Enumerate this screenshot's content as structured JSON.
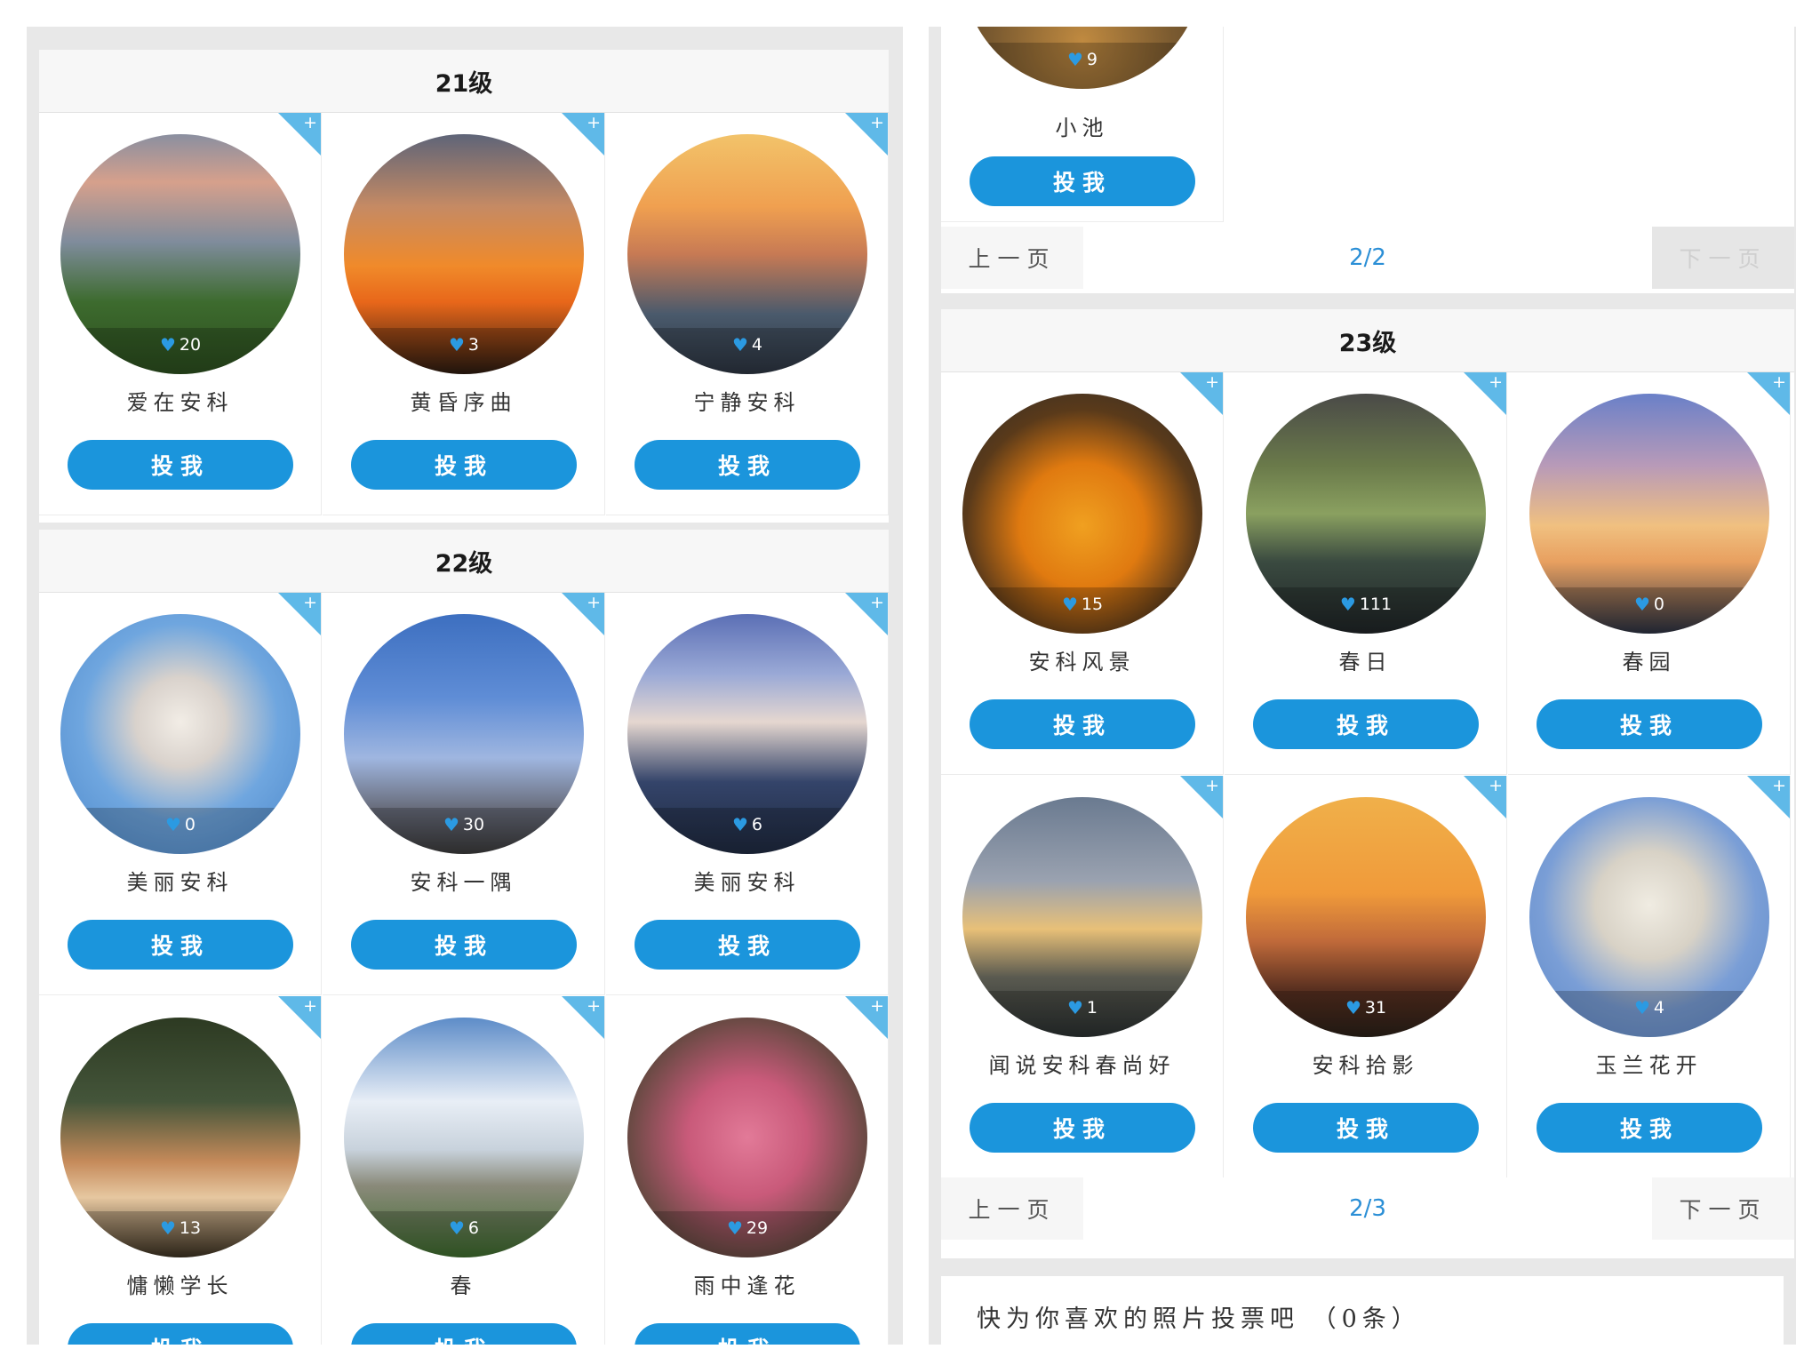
{
  "vote_label": "投我",
  "left": {
    "sections": [
      {
        "title": "21级",
        "cards": [
          {
            "title": "爱在安科",
            "likes": "20",
            "photo": "linear-gradient(180deg,#8a8fa0 0%,#d6a08c 20%,#7f8c9c 45%,#3d6b2e 70%,#2b4d1e 100%)"
          },
          {
            "title": "黄昏序曲",
            "likes": "3",
            "photo": "linear-gradient(180deg,#5e6478 0%,#c58a64 30%,#f08a2a 55%,#e8671a 70%,#2a1a10 100%)"
          },
          {
            "title": "宁静安科",
            "likes": "4",
            "photo": "linear-gradient(180deg,#f2c36a 0%,#f0a050 30%,#c77a54 50%,#4a5a6c 75%,#2c3440 100%)"
          }
        ]
      },
      {
        "title": "22级",
        "cards": [
          {
            "title": "美丽安科",
            "likes": "0",
            "photo": "radial-gradient(circle at 50% 45%,#f2ede6 0%,#d9d2cc 25%,#6fa6df 55%,#4a86c9 100%)"
          },
          {
            "title": "安科一隅",
            "likes": "30",
            "photo": "linear-gradient(180deg,#3d6fc0 0%,#5f8dd6 35%,#9fb6e0 60%,#6b7080 80%,#3a3a3a 100%)"
          },
          {
            "title": "美丽安科",
            "likes": "6",
            "photo": "linear-gradient(180deg,#5b6fb5 0%,#9aa9d6 25%,#e5d7d0 45%,#34446a 70%,#1f2a40 100%)"
          }
        ]
      },
      {
        "title": "",
        "cards": [
          {
            "title": "慵懒学长",
            "likes": "13",
            "photo": "linear-gradient(180deg,#2d3a22 0%,#44553a 35%,#c58a5a 60%,#e6c7a0 75%,#3a3020 100%)"
          },
          {
            "title": "春",
            "likes": "6",
            "photo": "linear-gradient(180deg,#5d8cc8 0%,#e8eef6 35%,#c8d2dc 55%,#8a8a7a 70%,#3d6a2d 100%)"
          },
          {
            "title": "雨中逢花",
            "likes": "29",
            "photo": "radial-gradient(circle at 50% 50%,#e27a98 0%,#c95a7a 35%,#6a4a44 70%,#3b3530 100%)"
          }
        ]
      }
    ]
  },
  "right": {
    "top_card": {
      "title": "小池",
      "likes": "9"
    },
    "top_pager": {
      "prev": "上一页",
      "page": "2/2",
      "next": "下一页"
    },
    "section": {
      "title": "23级",
      "cards": [
        {
          "title": "安科风景",
          "likes": "15",
          "photo": "radial-gradient(circle at 50% 55%,#f0a020 0%,#e07a10 35%,#5a3a1a 65%,#2a2a2a 100%)"
        },
        {
          "title": "春日",
          "likes": "111",
          "photo": "linear-gradient(180deg,#4a4a48 0%,#6a7a4a 30%,#8aa060 50%,#3a4a40 70%,#1f2426 100%)"
        },
        {
          "title": "春园",
          "likes": "0",
          "photo": "linear-gradient(180deg,#6a80c8 0%,#b89ab8 30%,#f0c080 55%,#e8a060 70%,#2a3040 100%)"
        },
        {
          "title": "闻说安科春尚好",
          "likes": "1",
          "photo": "linear-gradient(180deg,#6a7a90 0%,#9aa2b0 35%,#e8c078 55%,#5a5a50 75%,#2a3030 100%)"
        },
        {
          "title": "安科拾影",
          "likes": "31",
          "photo": "linear-gradient(180deg,#f0b04a 0%,#f09a3a 40%,#c06a3a 60%,#5a3020 80%,#2a2018 100%)"
        },
        {
          "title": "玉兰花开",
          "likes": "4",
          "photo": "radial-gradient(circle at 50% 45%,#f0ece2 0%,#d8d2c6 30%,#7a9ed6 60%,#5a86c6 100%)"
        }
      ]
    },
    "bottom_pager": {
      "prev": "上一页",
      "page": "2/3",
      "next": "下一页"
    },
    "footer_text": "快为你喜欢的照片投票吧 （0条）"
  }
}
